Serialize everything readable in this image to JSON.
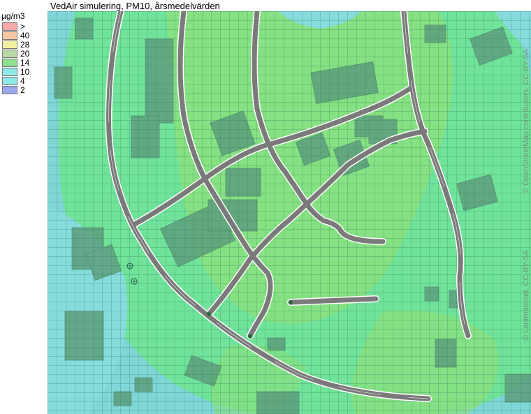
{
  "title": "VedAir simulering, PM10, årsmedelvärden",
  "legend": {
    "unit": "µg/m3",
    "items": [
      {
        "label": ">",
        "color": "#f7a8a8"
      },
      {
        "label": "40",
        "color": "#f5c7a0"
      },
      {
        "label": "28",
        "color": "#f2f0a0"
      },
      {
        "label": "20",
        "color": "#b8d8a8"
      },
      {
        "label": "14",
        "color": "#8ee08e"
      },
      {
        "label": "10",
        "color": "#8fe8e8"
      },
      {
        "label": "4",
        "color": "#8fe8e8"
      },
      {
        "label": "2",
        "color": "#9aa8ee"
      }
    ]
  },
  "attribution": {
    "osm": "© OpenStreetMap contributors, CC-BY-SA",
    "lm": "© Lantmäteriet, CC-BY-SA"
  },
  "colors": {
    "background_low": "#7fd8d8",
    "background_mid": "#6ee49a",
    "background_high": "#8fe27a",
    "grid": "#4a7a6a",
    "building": "#5a9a78",
    "road": "#7a7a7a",
    "road_edge": "#ffffff"
  }
}
